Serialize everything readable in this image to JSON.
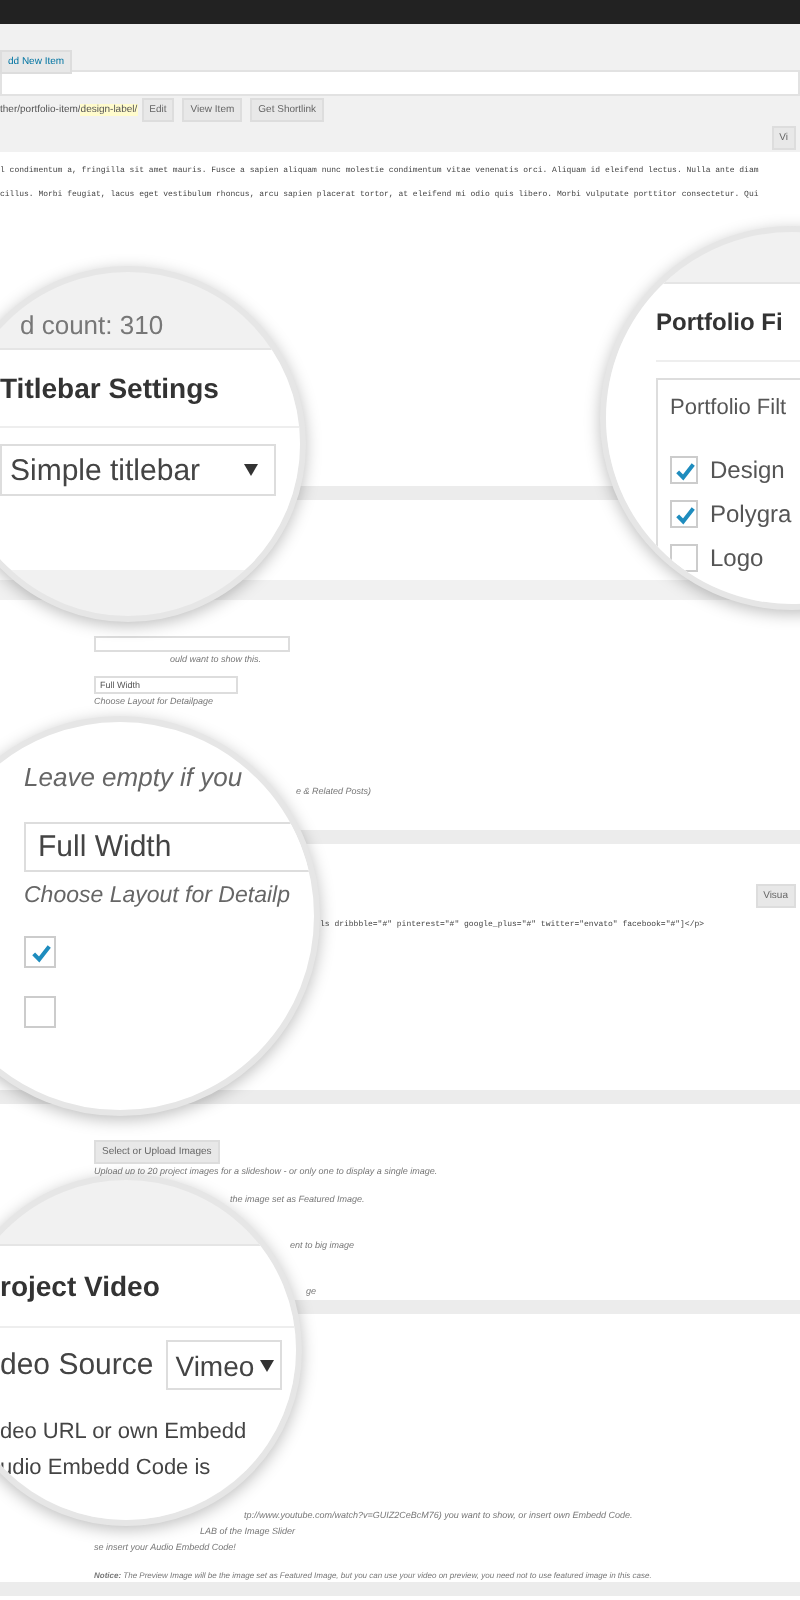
{
  "header_button": "dd New Item",
  "permalink": {
    "path": "ther/portfolio-item/",
    "slug": "design-label/",
    "buttons": [
      "Edit",
      "View Item",
      "Get Shortlink"
    ]
  },
  "editor_tab": "Vi",
  "content_lines": [
    "l condimentum a, fringilla sit amet mauris. Fusce a sapien aliquam nunc molestie condimentum vitae venenatis orci. Aliquam id eleifend lectus. Nulla ante diam",
    "cillus. Morbi feugiat, lacus eget vestibulum rhoncus, arcu sapien placerat tortor, at eleifend mi odio quis libero. Morbi vulputate porttitor consectetur. Qui"
  ],
  "word_count": "d count: 310",
  "titlebar": {
    "title": "Titlebar Settings",
    "select": "Simple titlebar"
  },
  "filters": {
    "title": "Portfolio Fi",
    "box_title": "Portfolio Filt",
    "items": [
      {
        "label": "Design",
        "checked": true
      },
      {
        "label": "Polygra",
        "checked": true
      },
      {
        "label": "Logo",
        "checked": false
      }
    ]
  },
  "detail_settings": {
    "hint": "ould want to show this.",
    "layout_select": "Full Width",
    "layout_hint": "Choose Layout for Detailpage",
    "related_hint": "e & Related Posts)"
  },
  "zoom_detail": {
    "hint": "Leave empty if you",
    "select": "Full Width",
    "select_hint": "Choose Layout for Detailp",
    "checkboxes": [
      {
        "checked": true
      },
      {
        "checked": false
      }
    ]
  },
  "code_editor": {
    "tab": "Visua",
    "line": "ls dribbble=\"#\" pinterest=\"#\" google_plus=\"#\" twitter=\"envato\" facebook=\"#\"]</p>"
  },
  "gallery": {
    "button": "Select or Upload Images",
    "hints": [
      "Upload up to 20 project images for a slideshow - or only one to display a single image.",
      "the image set as Featured Image.",
      "ent to big image",
      "ge"
    ]
  },
  "video": {
    "title": "roject Video",
    "source_label": "deo Source",
    "source": "Vimeo",
    "lines": [
      "deo URL or own Embedd",
      "udio Embedd Code is"
    ],
    "hints": [
      "tp://www.youtube.com/watch?v=GUIZ2CeBcM76) you want to show, or insert own Embedd Code.",
      "LAB of the Image Slider",
      "se insert your Audio Embedd Code!"
    ],
    "notice": "**Notice:** The Preview Image will be the image set as Featured Image, but you can use your video on preview, you need not to use featured image in this case."
  }
}
